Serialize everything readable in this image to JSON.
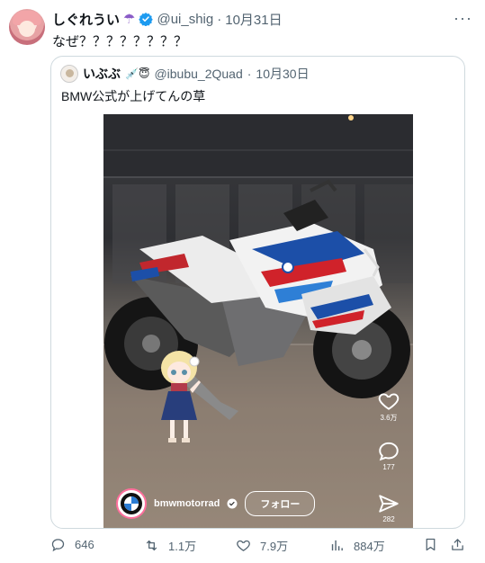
{
  "tweet": {
    "display_name": "しぐれうい",
    "name_emoji": "☂",
    "handle": "@ui_shig",
    "dot": "·",
    "date": "10月31日",
    "text": "なぜ？？？？？？？？",
    "more_label": "···"
  },
  "quote": {
    "display_name": "いぶぶ",
    "name_emoji": "💉😇",
    "handle": "@ibubu_2Quad",
    "dot": "·",
    "date": "10月30日",
    "text": "BMW公式が上げてんの草"
  },
  "video": {
    "like_count": "3.6万",
    "comment_count": "177",
    "share_count": "282",
    "channel_name": "bmwmotorrad",
    "follow_label": "フォロー"
  },
  "actions": {
    "replies": "646",
    "reposts": "1.1万",
    "likes": "7.9万",
    "views": "884万"
  },
  "colors": {
    "text": "#0f1419",
    "muted": "#536471",
    "border": "#cfd9de",
    "verified": "#1d9bf0"
  }
}
